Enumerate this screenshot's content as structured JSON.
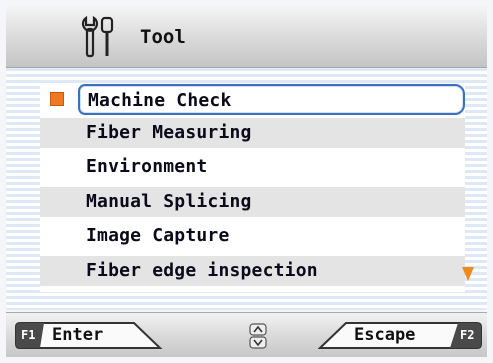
{
  "header": {
    "title": "Tool",
    "icon": "tools-icon"
  },
  "menu": {
    "items": [
      {
        "label": "Machine Check",
        "selected": true
      },
      {
        "label": "Fiber Measuring",
        "selected": false
      },
      {
        "label": "Environment",
        "selected": false
      },
      {
        "label": "Manual Splicing",
        "selected": false
      },
      {
        "label": "Image Capture",
        "selected": false
      },
      {
        "label": "Fiber edge inspection",
        "selected": false
      }
    ],
    "more_below_icon": "down-arrow-icon"
  },
  "footer": {
    "enter": {
      "key": "F1",
      "label": "Enter"
    },
    "escape": {
      "key": "F2",
      "label": "Escape"
    },
    "scroll_icon": "up-down-icon"
  },
  "colors": {
    "selection_border": "#3b6fc0",
    "selection_marker": "#f07820",
    "scroll_arrow": "#f08a1c",
    "button_key_bg": "#4a4a4a"
  }
}
